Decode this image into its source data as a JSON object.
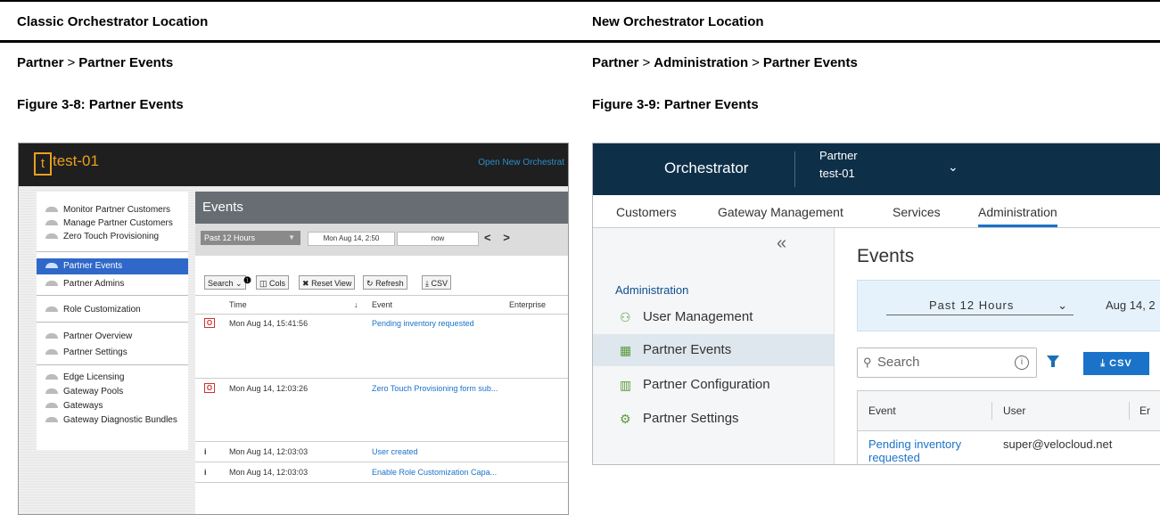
{
  "doc": {
    "col_left_header": "Classic Orchestrator Location",
    "col_right_header": "New Orchestrator Location",
    "left_path": [
      "Partner",
      "Partner Events"
    ],
    "right_path": [
      "Partner",
      "Administration",
      "Partner Events"
    ],
    "path_separator": ">",
    "left_figure": "Figure 3-8: Partner Events",
    "right_figure": "Figure 3-9: Partner Events"
  },
  "classic": {
    "logo_letter": "t",
    "title": "test-01",
    "open_new_link": "Open New Orchestrat",
    "sidebar_items": [
      "Monitor Partner Customers",
      "Manage Partner Customers",
      "Zero Touch Provisioning",
      "Partner Events",
      "Partner Admins",
      "Role Customization",
      "Partner Overview",
      "Partner Settings",
      "Edge Licensing",
      "Gateway Pools",
      "Gateways",
      "Gateway Diagnostic Bundles"
    ],
    "events_title": "Events",
    "range_select": "Past 12 Hours",
    "date_from": "Mon Aug 14, 2:50",
    "date_to": "now",
    "arrows": "< >",
    "tools": {
      "search": "Search",
      "cols": "Cols",
      "reset": "Reset View",
      "refresh": "Refresh",
      "csv": "CSV"
    },
    "columns": [
      "Time",
      "Event",
      "Enterprise"
    ],
    "rows": [
      {
        "icon": "O",
        "time": "Mon Aug 14, 15:41:56",
        "event": "Pending inventory requested"
      },
      {
        "icon": "O",
        "time": "Mon Aug 14, 12:03:26",
        "event": "Zero Touch Provisioning form sub..."
      },
      {
        "icon": "i",
        "time": "Mon Aug 14, 12:03:03",
        "event": "User created"
      },
      {
        "icon": "i",
        "time": "Mon Aug 14, 12:03:03",
        "event": "Enable Role Customization Capa..."
      }
    ]
  },
  "new_ui": {
    "brand": "Orchestrator",
    "context_label": "Partner",
    "context_value": "test-01",
    "tabs": [
      "Customers",
      "Gateway Management",
      "Services",
      "Administration"
    ],
    "section_header": "Administration",
    "nav_items": [
      "User Management",
      "Partner Events",
      "Partner Configuration",
      "Partner Settings"
    ],
    "page_title": "Events",
    "range": "Past 12 Hours",
    "date_start": "Aug 14, 2",
    "search_placeholder": "Search",
    "csv_label": "CSV",
    "columns": [
      "Event",
      "User",
      "Er"
    ],
    "rows": [
      {
        "event": "Pending inventory requested",
        "user": "super@velocloud.net"
      }
    ]
  }
}
